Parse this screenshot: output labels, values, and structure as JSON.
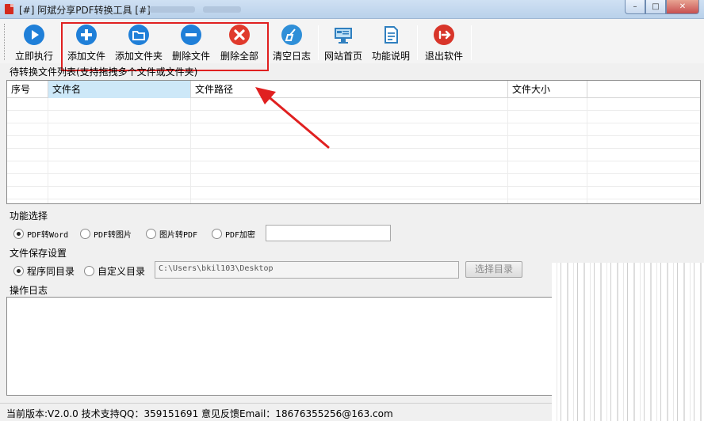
{
  "window": {
    "title": "[#] 阿斌分享PDF转换工具 [#]",
    "controls": {
      "minimize": "–",
      "maximize": "□",
      "close": "✕"
    }
  },
  "toolbar": {
    "buttons": [
      {
        "label": "立即执行",
        "icon": "play-icon",
        "color": "#1f7fd8"
      },
      {
        "label": "添加文件",
        "icon": "plus-icon",
        "color": "#1f7fd8"
      },
      {
        "label": "添加文件夹",
        "icon": "folder-icon",
        "color": "#1f7fd8"
      },
      {
        "label": "删除文件",
        "icon": "minus-icon",
        "color": "#1f7fd8"
      },
      {
        "label": "删除全部",
        "icon": "close-icon",
        "color": "#e03a2c"
      },
      {
        "label": "清空日志",
        "icon": "broom-icon",
        "color": "#2f8fd8"
      },
      {
        "label": "网站首页",
        "icon": "monitor-icon",
        "color": "#2f7fbf"
      },
      {
        "label": "功能说明",
        "icon": "document-icon",
        "color": "#2f7fbf"
      },
      {
        "label": "退出软件",
        "icon": "exit-icon",
        "color": "#d8352a"
      }
    ]
  },
  "file_list": {
    "caption": "待转换文件列表(支持拖拽多个文件或文件夹)",
    "columns": [
      "序号",
      "文件名",
      "文件路径",
      "文件大小"
    ]
  },
  "function": {
    "caption": "功能选择",
    "options": [
      "PDF转Word",
      "PDF转图片",
      "图片转PDF",
      "PDF加密"
    ],
    "selected": "PDF转Word",
    "password_value": ""
  },
  "save": {
    "caption": "文件保存设置",
    "options": [
      "程序同目录",
      "自定义目录"
    ],
    "selected": "程序同目录",
    "path_value": "C:\\Users\\bkil103\\Desktop",
    "browse_label": "选择目录"
  },
  "log": {
    "caption": "操作日志"
  },
  "status": {
    "text": "当前版本:V2.0.0  技术支持QQ：359151691  意见反馈Email：18676355256@163.com"
  },
  "colors": {
    "highlight": "#e02020",
    "arrow": "#e02020",
    "selected_header": "#cde8f8"
  }
}
